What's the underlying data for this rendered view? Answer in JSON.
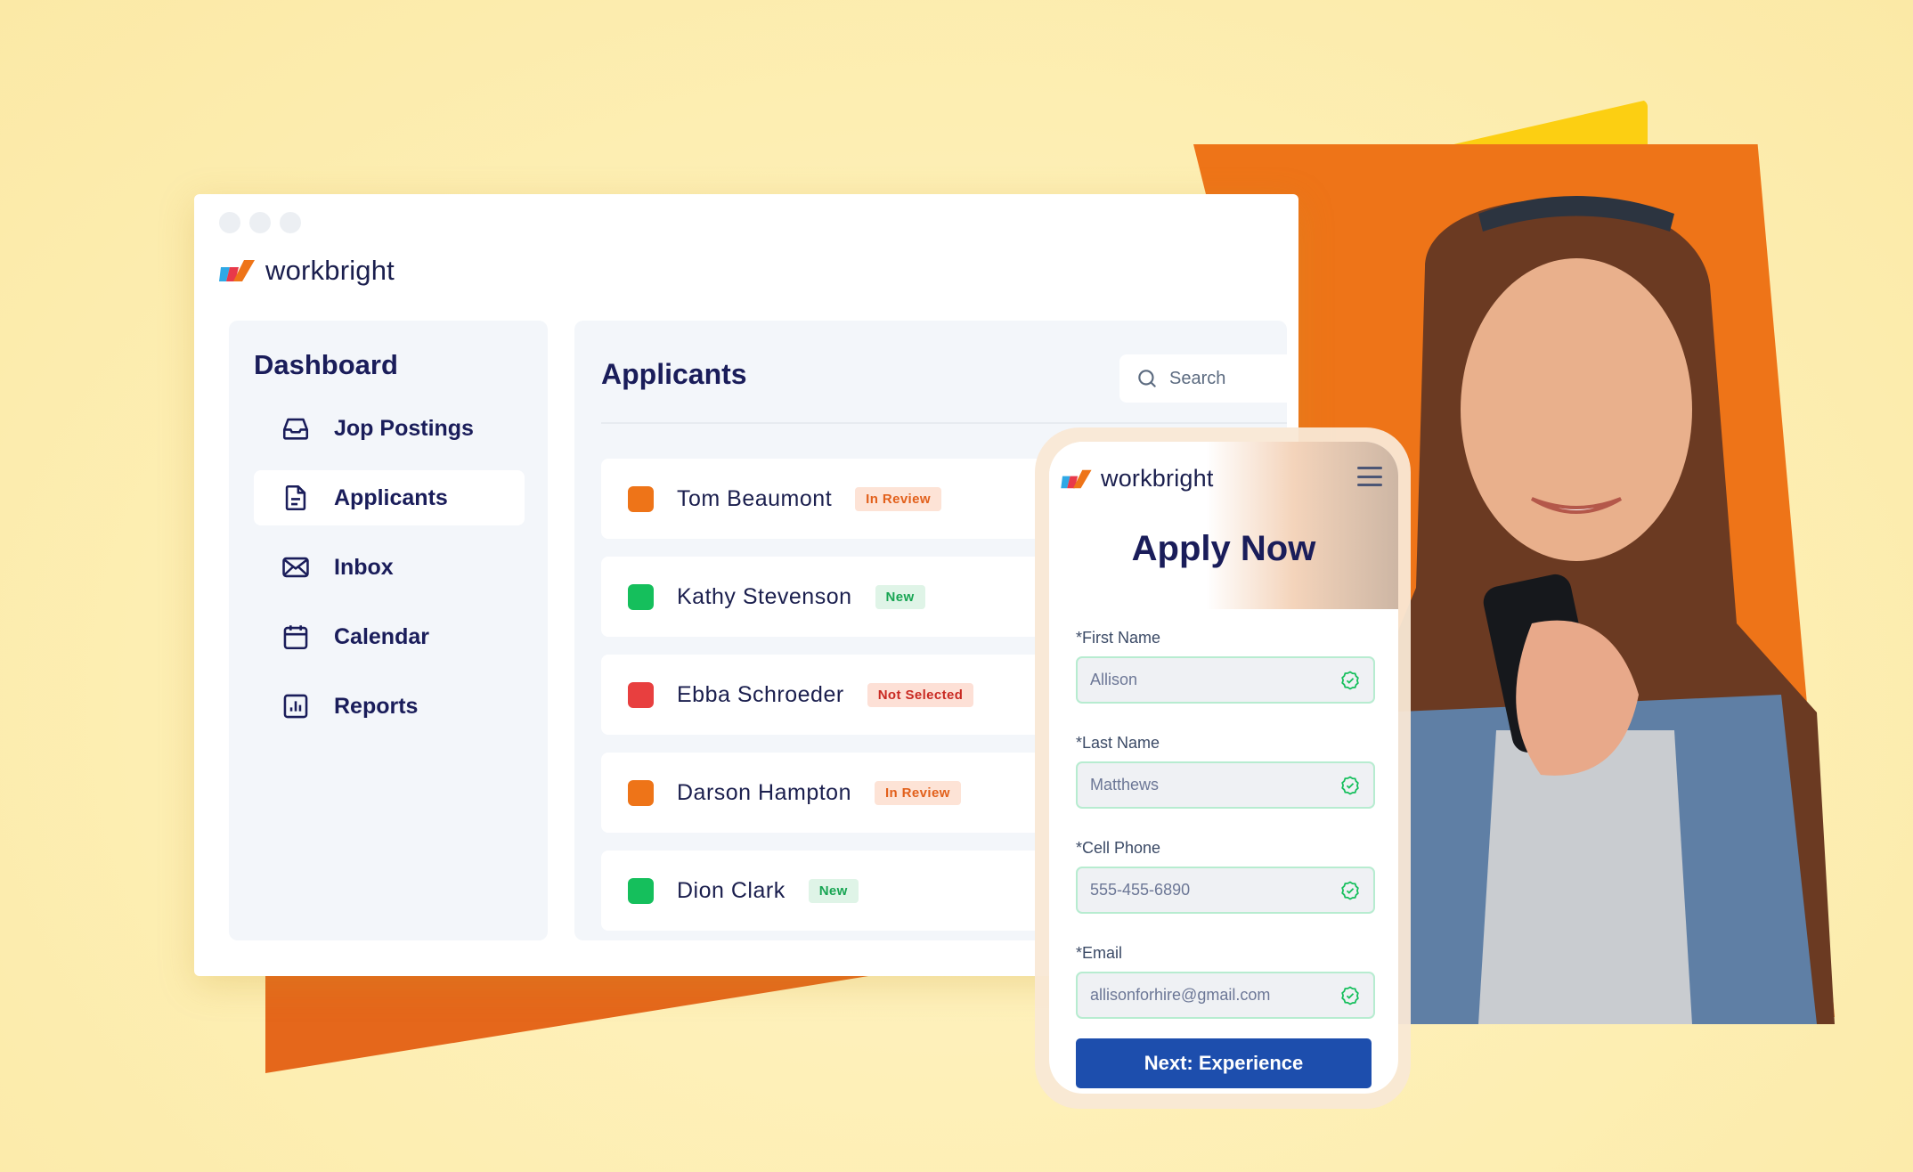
{
  "brand": {
    "name": "workbright"
  },
  "sidebar": {
    "title": "Dashboard",
    "items": [
      {
        "label": "Jop Postings",
        "icon": "inbox-tray-icon",
        "active": false
      },
      {
        "label": "Applicants",
        "icon": "document-icon",
        "active": true
      },
      {
        "label": "Inbox",
        "icon": "mail-icon",
        "active": false
      },
      {
        "label": "Calendar",
        "icon": "calendar-icon",
        "active": false
      },
      {
        "label": "Reports",
        "icon": "bar-chart-icon",
        "active": false
      }
    ]
  },
  "main": {
    "title": "Applicants",
    "search_placeholder": "Search",
    "applicants": [
      {
        "name": "Tom Beaumont",
        "status": "In Review",
        "dot_color": "#ee7418",
        "badge_bg": "#fde3d6",
        "badge_color": "#e2601b"
      },
      {
        "name": "Kathy Stevenson",
        "status": "New",
        "dot_color": "#15bf5c",
        "badge_bg": "#dff4e7",
        "badge_color": "#18a553"
      },
      {
        "name": "Ebba Schroeder",
        "status": "Not Selected",
        "dot_color": "#e83f3f",
        "badge_bg": "#fde0d6",
        "badge_color": "#c92a22"
      },
      {
        "name": "Darson Hampton",
        "status": "In Review",
        "dot_color": "#ee7418",
        "badge_bg": "#fde3d6",
        "badge_color": "#e2601b"
      },
      {
        "name": "Dion Clark",
        "status": "New",
        "dot_color": "#15bf5c",
        "badge_bg": "#dff4e7",
        "badge_color": "#18a553"
      }
    ]
  },
  "phone": {
    "title": "Apply Now",
    "fields": [
      {
        "label": "*First Name",
        "value": "Allison"
      },
      {
        "label": "*Last Name",
        "value": "Matthews"
      },
      {
        "label": "*Cell Phone",
        "value": "555-455-6890"
      },
      {
        "label": "*Email",
        "value": "allisonforhire@gmail.com"
      }
    ],
    "next_button": "Next: Experience"
  },
  "colors": {
    "navy": "#1a1d5a",
    "orange": "#ee7418",
    "yellow": "#fccf12",
    "primary_button": "#1d4ead",
    "valid_green": "#15bf5c"
  }
}
